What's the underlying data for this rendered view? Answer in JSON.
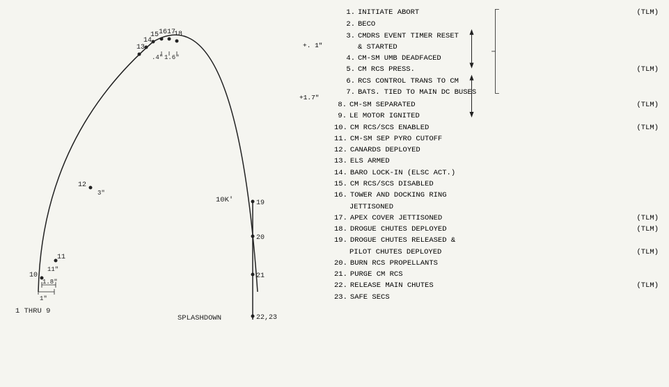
{
  "diagram": {
    "labels": {
      "splashdown": "SPLASHDOWN",
      "one_thru_nine": "1 THRU 9",
      "ten_k": "10K'"
    }
  },
  "events": [
    {
      "num": "1.",
      "text": "INITIATE ABORT",
      "tlm": "(TLM)",
      "indent": 0
    },
    {
      "num": "2.",
      "text": "BECO",
      "tlm": "",
      "indent": 0
    },
    {
      "num": "3.",
      "text": "CMDRS EVENT TIMER RESET",
      "tlm": "",
      "indent": 0,
      "cont": "& STARTED"
    },
    {
      "num": "4.",
      "text": "CM-SM UMB DEADFACED",
      "tlm": "",
      "indent": 0
    },
    {
      "num": "5.",
      "text": "CM RCS PRESS.",
      "tlm": "(TLM)",
      "indent": 0
    },
    {
      "num": "6.",
      "text": "RCS CONTROL TRANS TO CM",
      "tlm": "",
      "indent": 0
    },
    {
      "num": "7.",
      "text": "BATS. TIED TO MAIN DC BUSES",
      "tlm": "",
      "indent": 0
    },
    {
      "num": "8.",
      "text": "CM-SM SEPARATED",
      "tlm": "(TLM)",
      "indent": 0
    },
    {
      "num": "9.",
      "text": "LE MOTOR IGNITED",
      "tlm": "",
      "indent": 0
    },
    {
      "num": "10.",
      "text": "CM RCS/SCS ENABLED",
      "tlm": "(TLM)",
      "indent": 0
    },
    {
      "num": "11.",
      "text": "CM-SM SEP PYRO CUTOFF",
      "tlm": "",
      "indent": 0
    },
    {
      "num": "12.",
      "text": "CANARDS DEPLOYED",
      "tlm": "",
      "indent": 0
    },
    {
      "num": "13.",
      "text": "ELS ARMED",
      "tlm": "",
      "indent": 0
    },
    {
      "num": "14.",
      "text": "BARO LOCK-IN (ELSC ACT.)",
      "tlm": "",
      "indent": 0
    },
    {
      "num": "15.",
      "text": "CM RCS/SCS DISABLED",
      "tlm": "",
      "indent": 0
    },
    {
      "num": "16.",
      "text": "TOWER AND DOCKING RING",
      "tlm": "",
      "indent": 0,
      "cont": "JETTISONED"
    },
    {
      "num": "17.",
      "text": "APEX COVER JETTISONED",
      "tlm": "(TLM)",
      "indent": 0
    },
    {
      "num": "18.",
      "text": "DROGUE CHUTES DEPLOYED",
      "tlm": "(TLM)",
      "indent": 0
    },
    {
      "num": "19.",
      "text": "DROGUE CHUTES RELEASED &",
      "tlm": "",
      "indent": 0,
      "cont": "PILOT CHUTES DEPLOYED",
      "cont_tlm": "(TLM)"
    },
    {
      "num": "20.",
      "text": "BURN RCS PROPELLANTS",
      "tlm": "",
      "indent": 0
    },
    {
      "num": "21.",
      "text": "PURGE CM RCS",
      "tlm": "",
      "indent": 0
    },
    {
      "num": "22.",
      "text": "RELEASE MAIN CHUTES",
      "tlm": "(TLM)",
      "indent": 0
    },
    {
      "num": "23.",
      "text": "SAFE SECS",
      "tlm": "",
      "indent": 0
    }
  ]
}
